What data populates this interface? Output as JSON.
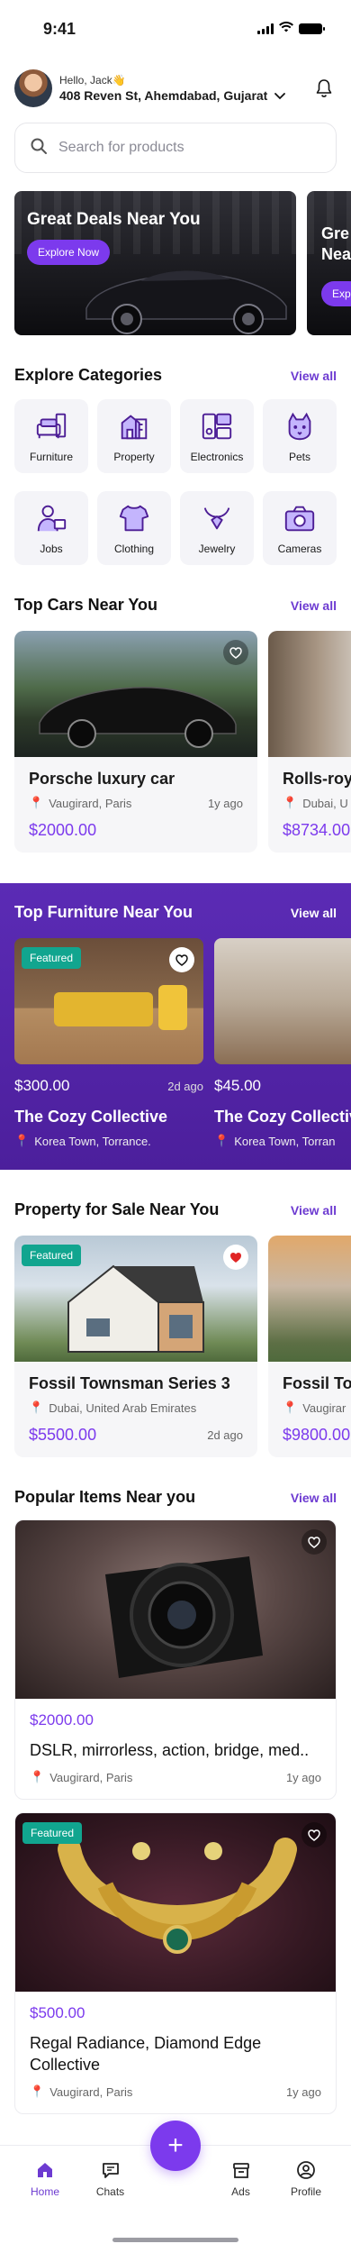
{
  "status": {
    "time": "9:41"
  },
  "header": {
    "greeting": "Hello, Jack👋",
    "address": "408 Reven St, Ahemdabad, Gujarat"
  },
  "search": {
    "placeholder": "Search for products"
  },
  "banners": [
    {
      "title": "Great Deals Near You",
      "cta": "Explore Now"
    },
    {
      "title": "Gre\nNea",
      "cta": "Exp"
    }
  ],
  "categories": {
    "title": "Explore Categories",
    "view_all": "View all",
    "items": [
      {
        "label": "Furniture",
        "icon": "furniture-icon"
      },
      {
        "label": "Property",
        "icon": "property-icon"
      },
      {
        "label": "Electronics",
        "icon": "electronics-icon"
      },
      {
        "label": "Pets",
        "icon": "pets-icon"
      },
      {
        "label": "Jobs",
        "icon": "jobs-icon"
      },
      {
        "label": "Clothing",
        "icon": "clothing-icon"
      },
      {
        "label": "Jewelry",
        "icon": "jewelry-icon"
      },
      {
        "label": "Cameras",
        "icon": "cameras-icon"
      }
    ]
  },
  "cars": {
    "title": "Top Cars Near You",
    "view_all": "View all",
    "items": [
      {
        "title": "Porsche luxury car",
        "location": "Vaugirard, Paris",
        "ago": "1y ago",
        "price": "$2000.00"
      },
      {
        "title": "Rolls-royc",
        "location": "Dubai, U",
        "ago": "",
        "price": "$8734.00"
      }
    ]
  },
  "furniture": {
    "title": "Top Furniture Near You",
    "view_all": "View all",
    "items": [
      {
        "featured": "Featured",
        "price": "$300.00",
        "ago": "2d ago",
        "title": "The Cozy Collective",
        "location": "Korea Town, Torrance."
      },
      {
        "featured": "",
        "price": "$45.00",
        "ago": "",
        "title": "The Cozy Collectiv",
        "location": "Korea Town, Torran"
      }
    ]
  },
  "property": {
    "title": "Property for Sale Near You",
    "view_all": "View all",
    "items": [
      {
        "featured": "Featured",
        "title": "Fossil Townsman Series 3",
        "location": "Dubai, United Arab Emirates",
        "price": "$5500.00",
        "ago": "2d ago"
      },
      {
        "featured": "",
        "title": "Fossil Tow",
        "location": "Vaugirar",
        "price": "$9800.00",
        "ago": ""
      }
    ]
  },
  "popular": {
    "title": "Popular Items Near you",
    "view_all": "View all",
    "items": [
      {
        "price": "$2000.00",
        "title": "DSLR, mirrorless, action, bridge, med..",
        "location": "Vaugirard, Paris",
        "ago": "1y ago",
        "featured": ""
      },
      {
        "price": "$500.00",
        "title": "Regal Radiance, Diamond Edge Collective",
        "location": "Vaugirard, Paris",
        "ago": "1y ago",
        "featured": "Featured"
      }
    ]
  },
  "nav": {
    "items": [
      {
        "label": "Home",
        "icon": "home-icon",
        "active": true
      },
      {
        "label": "Chats",
        "icon": "chat-icon"
      },
      {
        "label": "",
        "icon": "plus-icon"
      },
      {
        "label": "Ads",
        "icon": "ads-icon"
      },
      {
        "label": "Profile",
        "icon": "profile-icon"
      }
    ],
    "fab_label": "+"
  },
  "colors": {
    "accent": "#7c3aed",
    "accent_dark": "#4c1f9c",
    "featured": "#11a58f",
    "heart_red": "#e02424"
  }
}
